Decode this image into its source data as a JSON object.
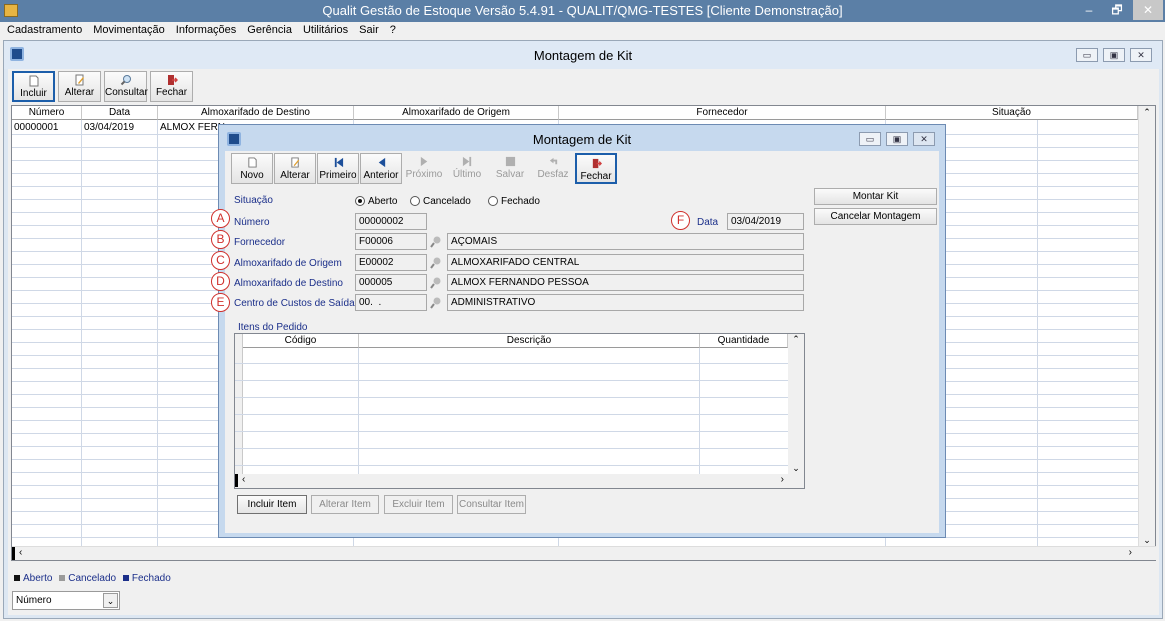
{
  "app": {
    "title": "Qualit Gestão de Estoque Versão 5.4.91 - QUALIT/QMG-TESTES [Cliente Demonstração]",
    "window_controls": {
      "minimize": "–",
      "restore": "🗗",
      "close": "✕"
    }
  },
  "menu": {
    "items": [
      "Cadastramento",
      "Movimentação",
      "Informações",
      "Gerência",
      "Utilitários",
      "Sair",
      "?"
    ]
  },
  "outer": {
    "title": "Montagem de Kit",
    "toolbar": {
      "incluir": "Incluir",
      "alterar": "Alterar",
      "consultar": "Consultar",
      "fechar": "Fechar"
    },
    "grid": {
      "columns": [
        "Número",
        "Data",
        "Almoxarifado de Destino",
        "Almoxarifado de Origem",
        "Fornecedor",
        "Situação"
      ],
      "rows": [
        [
          "00000001",
          "03/04/2019",
          "ALMOX FERN",
          "",
          "",
          ""
        ]
      ]
    },
    "legend": {
      "aberto": "Aberto",
      "cancelado": "Cancelado",
      "fechado": "Fechado"
    },
    "order_select": {
      "value": "Número"
    }
  },
  "dialog": {
    "title": "Montagem de Kit",
    "toolbar": {
      "novo": "Novo",
      "alterar": "Alterar",
      "primeiro": "Primeiro",
      "anterior": "Anterior",
      "proximo": "Próximo",
      "ultimo": "Último",
      "salvar": "Salvar",
      "desfaz": "Desfaz",
      "fechar": "Fechar"
    },
    "situacao": {
      "label": "Situação",
      "options": [
        "Aberto",
        "Cancelado",
        "Fechado"
      ],
      "selected": "Aberto"
    },
    "numero": {
      "marker": "A",
      "label": "Número",
      "value": "00000002"
    },
    "fornecedor": {
      "marker": "B",
      "label": "Fornecedor",
      "code": "F00006",
      "name": "AÇOMAIS"
    },
    "alm_origem": {
      "marker": "C",
      "label": "Almoxarifado de Origem",
      "code": "E00002",
      "name": "ALMOXARIFADO CENTRAL"
    },
    "alm_destino": {
      "marker": "D",
      "label": "Almoxarifado de Destino",
      "code": "000005",
      "name": "ALMOX FERNANDO PESSOA"
    },
    "centro_custos": {
      "marker": "E",
      "label": "Centro de Custos de Saída",
      "code": "00.  .",
      "name": "ADMINISTRATIVO"
    },
    "data": {
      "marker": "F",
      "label": "Data",
      "value": "03/04/2019"
    },
    "actions": {
      "montar": "Montar Kit",
      "cancelar": "Cancelar Montagem"
    },
    "itens": {
      "label": "Itens do Pedido",
      "columns": [
        "Código",
        "Descrição",
        "Quantidade"
      ],
      "buttons": {
        "incluir": "Incluir Item",
        "alterar": "Alterar Item",
        "excluir": "Excluir Item",
        "consultar": "Consultar Item"
      }
    }
  }
}
